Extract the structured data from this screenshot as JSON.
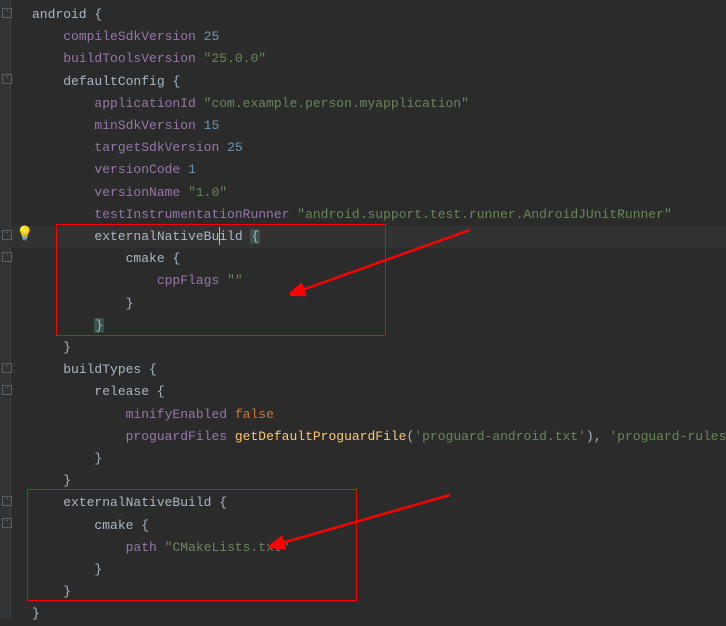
{
  "code": {
    "android": "android",
    "compileSdkVersion": "compileSdkVersion",
    "compileSdkValue": "25",
    "buildToolsVersion": "buildToolsVersion",
    "buildToolsValue": "\"25.0.0\"",
    "defaultConfig": "defaultConfig",
    "applicationId": "applicationId",
    "applicationIdValue": "\"com.example.person.myapplication\"",
    "minSdkVersion": "minSdkVersion",
    "minSdkValue": "15",
    "targetSdkVersion": "targetSdkVersion",
    "targetSdkValue": "25",
    "versionCode": "versionCode",
    "versionCodeValue": "1",
    "versionName": "versionName",
    "versionNameValue": "\"1.0\"",
    "testRunner": "testInstrumentationRunner",
    "testRunnerValue": "\"android.support.test.runner.AndroidJUnitRunner\"",
    "externalNativeBuild": "externalNativeBuild",
    "cmake": "cmake",
    "cppFlags": "cppFlags",
    "cppFlagsValue": "\"\"",
    "buildTypes": "buildTypes",
    "release": "release",
    "minifyEnabled": "minifyEnabled",
    "falseVal": "false",
    "proguardFiles": "proguardFiles",
    "getDefaultProguardFile": "getDefaultProguardFile",
    "proguardAndroid": "'proguard-android.txt'",
    "proguardRules": "'proguard-rules.pro'",
    "path": "path",
    "cmakeLists": "\"CMakeLists.txt\"",
    "brace_open": "{",
    "brace_close": "}",
    "paren_open": "(",
    "paren_close": ")",
    "comma": ", "
  },
  "icons": {
    "bulb": "💡"
  }
}
